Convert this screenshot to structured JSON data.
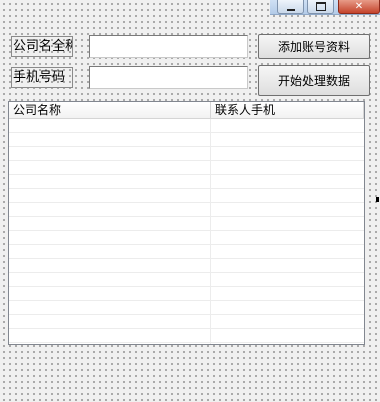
{
  "window": {
    "minimize_icon": "minimize-icon",
    "restore_icon": "maximize-icon",
    "close_glyph": "✕",
    "close_icon": "close-icon"
  },
  "form": {
    "company_full_name_label": "公司名全称",
    "company_full_name_value": "",
    "phone_label": "手机号码",
    "phone_value": "",
    "add_account_button": "添加账号资料",
    "start_processing_button": "开始处理数据"
  },
  "list": {
    "columns": [
      "公司名称",
      "联系人手机"
    ],
    "rows": []
  }
}
